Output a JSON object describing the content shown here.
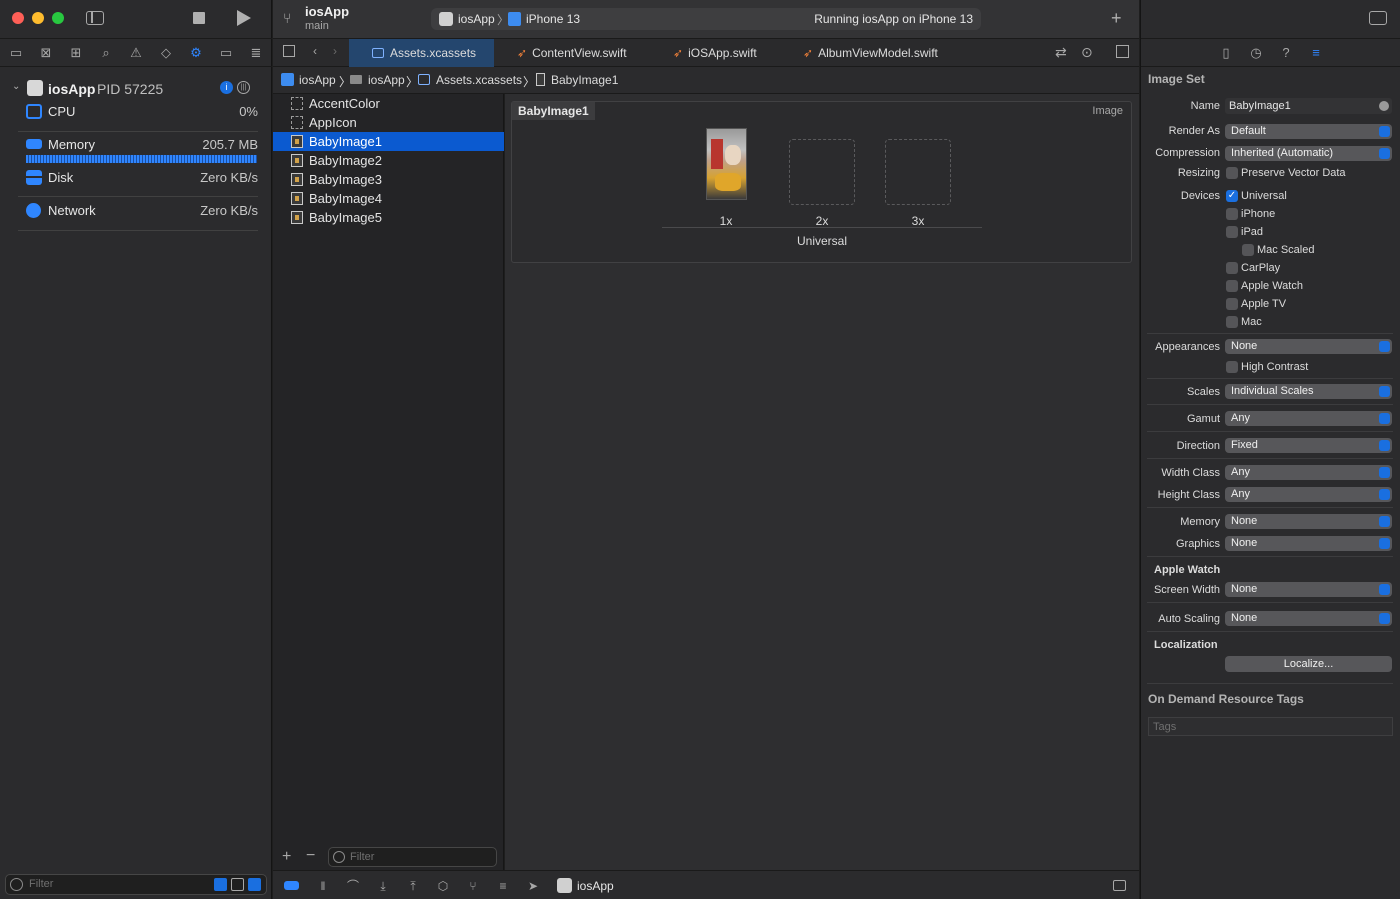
{
  "window": {
    "app_name": "iosApp",
    "branch": "main",
    "scheme": "iosApp",
    "destination": "iPhone 13",
    "activity_status": "Running iosApp on iPhone 13"
  },
  "debug_navigator": {
    "process_name": "iosApp",
    "process_pid": "PID 57225",
    "gauges": [
      {
        "label": "CPU",
        "value": "0%"
      },
      {
        "label": "Memory",
        "value": "205.7 MB"
      },
      {
        "label": "Disk",
        "value": "Zero KB/s"
      },
      {
        "label": "Network",
        "value": "Zero KB/s"
      }
    ],
    "memory_usage_fraction": 1.0,
    "filter_placeholder": "Filter"
  },
  "tabs": [
    {
      "label": "Assets.xcassets",
      "active": true
    },
    {
      "label": "ContentView.swift",
      "active": false
    },
    {
      "label": "iOSApp.swift",
      "active": false
    },
    {
      "label": "AlbumViewModel.swift",
      "active": false
    }
  ],
  "breadcrumb": [
    "iosApp",
    "iosApp",
    "Assets.xcassets",
    "BabyImage1"
  ],
  "asset_list": {
    "items": [
      {
        "label": "AccentColor",
        "kind": "color"
      },
      {
        "label": "AppIcon",
        "kind": "appicon"
      },
      {
        "label": "BabyImage1",
        "kind": "image",
        "selected": true
      },
      {
        "label": "BabyImage2",
        "kind": "image"
      },
      {
        "label": "BabyImage3",
        "kind": "image"
      },
      {
        "label": "BabyImage4",
        "kind": "image"
      },
      {
        "label": "BabyImage5",
        "kind": "image"
      }
    ],
    "filter_placeholder": "Filter"
  },
  "image_set": {
    "title": "BabyImage1",
    "type_label": "Image",
    "slots": [
      "1x",
      "2x",
      "3x"
    ],
    "group_label": "Universal"
  },
  "bottom_bar": {
    "target_label": "iosApp"
  },
  "inspector": {
    "section_title": "Image Set",
    "name_label": "Name",
    "name_value": "BabyImage1",
    "render_as_label": "Render As",
    "render_as_value": "Default",
    "compression_label": "Compression",
    "compression_value": "Inherited (Automatic)",
    "resizing_label": "Resizing",
    "preserve_vector_label": "Preserve Vector Data",
    "devices_label": "Devices",
    "devices": [
      {
        "label": "Universal",
        "checked": true
      },
      {
        "label": "iPhone",
        "checked": false
      },
      {
        "label": "iPad",
        "checked": false
      },
      {
        "label": "Mac Scaled",
        "checked": false
      },
      {
        "label": "CarPlay",
        "checked": false
      },
      {
        "label": "Apple Watch",
        "checked": false
      },
      {
        "label": "Apple TV",
        "checked": false
      },
      {
        "label": "Mac",
        "checked": false
      }
    ],
    "appearances_label": "Appearances",
    "appearances_value": "None",
    "high_contrast_label": "High Contrast",
    "scales_label": "Scales",
    "scales_value": "Individual Scales",
    "gamut_label": "Gamut",
    "gamut_value": "Any",
    "direction_label": "Direction",
    "direction_value": "Fixed",
    "width_class_label": "Width Class",
    "width_class_value": "Any",
    "height_class_label": "Height Class",
    "height_class_value": "Any",
    "memory_label": "Memory",
    "memory_value": "None",
    "graphics_label": "Graphics",
    "graphics_value": "None",
    "apple_watch_header": "Apple Watch",
    "screen_width_label": "Screen Width",
    "screen_width_value": "None",
    "auto_scaling_label": "Auto Scaling",
    "auto_scaling_value": "None",
    "localization_header": "Localization",
    "localize_button": "Localize...",
    "odr_header": "On Demand Resource Tags",
    "tags_placeholder": "Tags"
  },
  "colors": {
    "accent": "#1a6fe0",
    "selection": "#0b5ad0",
    "active_tab": "#24466e",
    "swift_orange": "#f0803a"
  }
}
